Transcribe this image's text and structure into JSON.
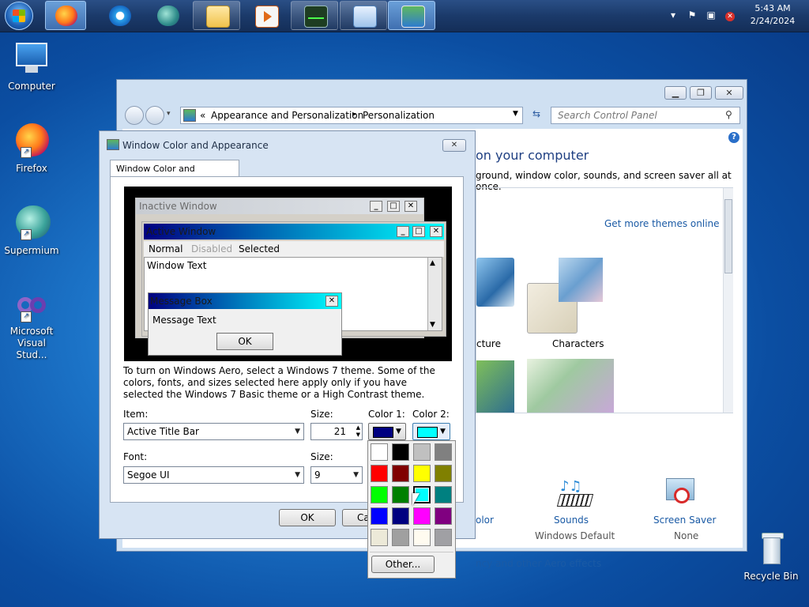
{
  "taskbar": {
    "clock_time": "5:43 AM",
    "clock_date": "2/24/2024",
    "tray_arrow": "▾"
  },
  "desktop": {
    "computer": "Computer",
    "firefox": "Firefox",
    "supermium": "Supermium",
    "vs": "Microsoft Visual Stud...",
    "recycle": "Recycle Bin"
  },
  "cp": {
    "breadcrumb_sep": "«",
    "crumb1": "Appearance and Personalization",
    "crumb_arrow": "▸",
    "crumb2": "Personalization",
    "search_placeholder": "Search Control Panel",
    "heading": "on your computer",
    "subheading": "ground, window color, sounds, and screen saver all at once.",
    "more_themes": "Get more themes online",
    "theme1": "cture",
    "theme2": "Characters",
    "color_label": "olor",
    "sounds": "Sounds",
    "sounds_value": "Windows Default",
    "screensaver": "Screen Saver",
    "screensaver_value": "None",
    "aero_link": "ncy and other Aero effects"
  },
  "dialog": {
    "title": "Window Color and Appearance",
    "close": "✕",
    "tab": "Window Color and Appearance",
    "preview": {
      "inactive_title": "Inactive Window",
      "active_title": "Active Window",
      "menu_normal": "Normal",
      "menu_disabled": "Disabled",
      "menu_selected": "Selected",
      "window_text": "Window Text",
      "msgbox_title": "Message Box",
      "msgbox_text": "Message Text",
      "ok": "OK"
    },
    "info": "To turn on Windows Aero, select a Windows 7 theme.  Some of the colors, fonts, and sizes selected here apply only if you have selected the Windows 7 Basic theme or a High Contrast theme.",
    "item_label": "Item:",
    "item_value": "Active Title Bar",
    "size_label": "Size:",
    "size_value": "21",
    "color1_label": "Color 1:",
    "color2_label": "Color 2:",
    "font_label": "Font:",
    "font_value": "Segoe UI",
    "font_size_label": "Size:",
    "font_size_value": "9",
    "ok": "OK",
    "cancel": "Ca"
  },
  "palette": {
    "other": "Other...",
    "colors": [
      "#ffffff",
      "#000000",
      "#c0c0c0",
      "#808080",
      "#ff0000",
      "#800000",
      "#ffff00",
      "#808000",
      "#00ff00",
      "#008000",
      "#00ffff",
      "#008080",
      "#0000ff",
      "#000080",
      "#ff00ff",
      "#800080",
      "#ece9d8",
      "#a0a0a0",
      "#fffbf0",
      "#a0a0a4"
    ],
    "selected_index": 10
  },
  "colors": {
    "color1": "#000080",
    "color2": "#00ffff",
    "link": "#1a5aa5"
  }
}
